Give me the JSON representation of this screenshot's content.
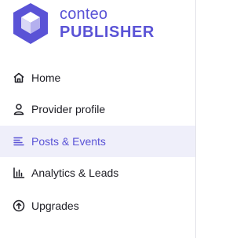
{
  "brand": {
    "line1": "conteo",
    "line2": "PUBLISHER",
    "color": "#5a53d6",
    "logo_icon": "cube-icon"
  },
  "nav": {
    "active_index": 2,
    "items": [
      {
        "label": "Home",
        "icon": "home-icon"
      },
      {
        "label": "Provider profile",
        "icon": "user-icon"
      },
      {
        "label": "Posts & Events",
        "icon": "list-icon"
      },
      {
        "label": "Analytics & Leads",
        "icon": "bar-chart-icon"
      },
      {
        "label": "Upgrades",
        "icon": "arrow-up-circle-icon"
      }
    ]
  },
  "colors": {
    "active_bg": "#efeffa",
    "active_text": "#5a53d6",
    "text": "#1d1d24"
  }
}
